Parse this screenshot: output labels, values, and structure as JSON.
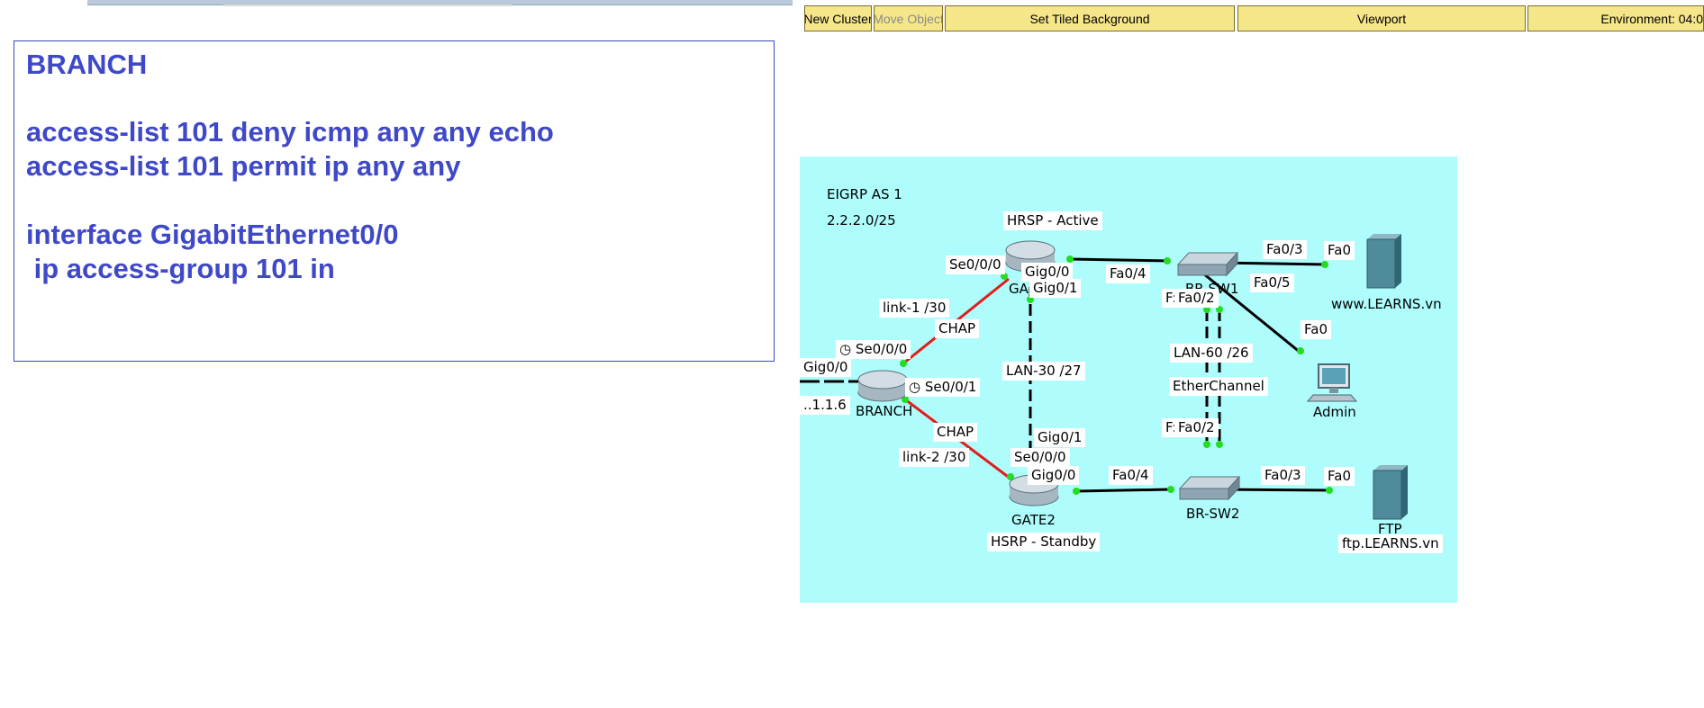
{
  "toolbar": {
    "new_cluster": "New Cluster",
    "move_object": "Move Object",
    "set_tiled_background": "Set Tiled Background",
    "viewport": "Viewport",
    "environment": "Environment: 04:0"
  },
  "note": {
    "lines": [
      "BRANCH",
      "access-list 101 deny icmp any any echo",
      "access-list 101 permit ip any any",
      "interface GigabitEthernet0/0",
      " ip access-group 101 in"
    ]
  },
  "topology": {
    "eigrp": "EIGRP AS 1",
    "network": "2.2.2.0/25",
    "hrsp_active": "HRSP - Active",
    "hsrp_standby": "HSRP - Standby",
    "link1": "link-1 /30",
    "link2": "link-2 /30",
    "chap1": "CHAP",
    "chap2": "CHAP",
    "lan30": "LAN-30 /27",
    "lan60": "LAN-60 /26",
    "etherchannel": "EtherChannel",
    "devices": {
      "gate1": "GA",
      "gate2": "GATE2",
      "branch": "BRANCH",
      "brsw1": "BR-SW1",
      "brsw2": "BR-SW2",
      "www": "www.LEARNS.vn",
      "admin": "Admin",
      "ftp_name": "FTP",
      "ftp": "ftp.LEARNS.vn"
    },
    "ports": {
      "g1_se000": "Se0/0/0",
      "g1_gig00": "Gig0/0",
      "g1_gig01": "Gig0/1",
      "sw1_fa04": "Fa0/4",
      "sw1_fa03": "Fa0/3",
      "www_fa0": "Fa0",
      "sw1_fa05": "Fa0/5",
      "sw1_fa01": "F:",
      "sw1_fa02": "Fa0/2",
      "admin_fa0": "Fa0",
      "br_se000": "Se0/0/0",
      "br_gig00": "Gig0/0",
      "br_se001": "Se0/0/1",
      "br_ip": "..1.1.6",
      "sw2_fa01": "F:",
      "sw2_fa02": "Fa0/2",
      "g2_gig01": "Gig0/1",
      "g2_se000": "Se0/0/0",
      "g2_gig00": "Gig0/0",
      "sw2_fa04": "Fa0/4",
      "sw2_fa03": "Fa0/3",
      "ftp_fa0": "Fa0"
    }
  }
}
